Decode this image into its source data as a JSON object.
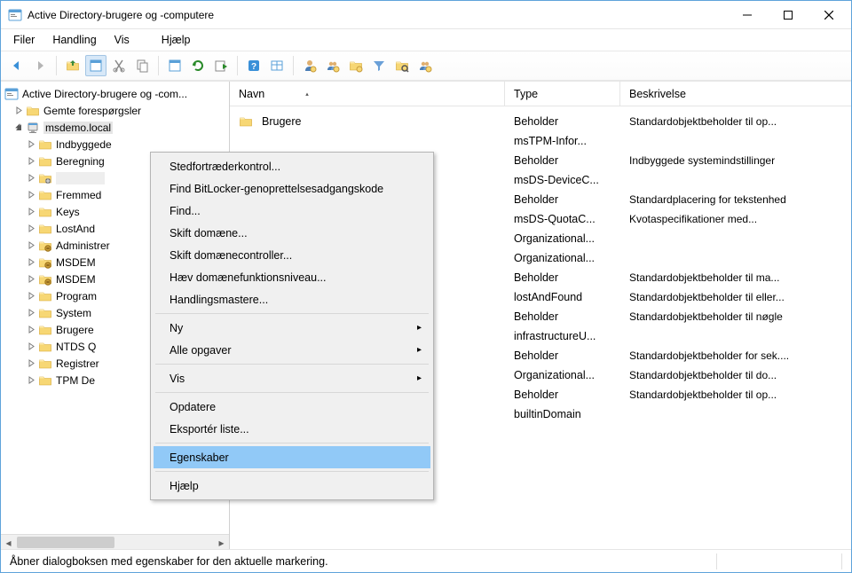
{
  "window": {
    "title": "Active Directory-brugere og -computere"
  },
  "menubar": {
    "items": [
      "Filer",
      "Handling",
      "Vis",
      "Hjælp"
    ]
  },
  "tree": {
    "root": "Active Directory-brugere og -com...",
    "saved": "Gemte forespørgsler",
    "domain": "msdemo.local",
    "children": [
      "Indbyggede",
      "Beregning",
      "",
      "Fremmed",
      "Keys",
      "LostAnd",
      "Administrer",
      "MSDEM",
      "MSDEM",
      "Program",
      "System",
      "Brugere",
      "NTDS Q",
      "Registrer",
      "TPM De"
    ]
  },
  "list": {
    "columns": {
      "name": "Navn",
      "type": "Type",
      "desc": "Beskrivelse"
    },
    "rows": [
      {
        "name": "Brugere",
        "type": "Beholder",
        "desc": "Standardobjektbeholder til op..."
      },
      {
        "name": "",
        "type": "msTPM-Infor...",
        "desc": ""
      },
      {
        "name": "",
        "type": "Beholder",
        "desc": "Indbyggede systemindstillinger"
      },
      {
        "name": "",
        "type": "msDS-DeviceC...",
        "desc": ""
      },
      {
        "name": "",
        "type": "Beholder",
        "desc": "Standardplacering for tekstenhed"
      },
      {
        "name": "",
        "type": "msDS-QuotaC...",
        "desc": "Kvotaspecifikationer med..."
      },
      {
        "name": "",
        "type": "Organizational...",
        "desc": ""
      },
      {
        "name": "",
        "type": "Organizational...",
        "desc": ""
      },
      {
        "name": "",
        "type": "Beholder",
        "desc": "Standardobjektbeholder til ma..."
      },
      {
        "name": "",
        "type": "lostAndFound",
        "desc": "Standardobjektbeholder til eller..."
      },
      {
        "name": "",
        "type": "Beholder",
        "desc": "Standardobjektbeholder til nøgle"
      },
      {
        "name": "",
        "type": "infrastructureU...",
        "desc": ""
      },
      {
        "name": "",
        "type": "Beholder",
        "desc": "Standardobjektbeholder for sek...."
      },
      {
        "name": "",
        "type": "Organizational...",
        "desc": "Standardobjektbeholder til do..."
      },
      {
        "name": "",
        "type": "Beholder",
        "desc": "Standardobjektbeholder til op..."
      },
      {
        "name": "",
        "type": "builtinDomain",
        "desc": ""
      }
    ]
  },
  "contextmenu": {
    "items": [
      {
        "label": "Stedfortræderkontrol...",
        "sub": false
      },
      {
        "label": "Find BitLocker-genoprettelsesadgangskode",
        "sub": false
      },
      {
        "label": "Find...",
        "sub": false
      },
      {
        "label": "Skift domæne...",
        "sub": false
      },
      {
        "label": "Skift domænecontroller...",
        "sub": false
      },
      {
        "label": "Hæv domænefunktionsniveau...",
        "sub": false
      },
      {
        "label": "Handlingsmastere...",
        "sub": false
      },
      {
        "sep": true
      },
      {
        "label": "Ny",
        "sub": true
      },
      {
        "label": "Alle opgaver",
        "sub": true
      },
      {
        "sep": true
      },
      {
        "label": "Vis",
        "sub": true
      },
      {
        "sep": true
      },
      {
        "label": "Opdatere",
        "sub": false
      },
      {
        "label": "Eksportér liste...",
        "sub": false
      },
      {
        "sep": true
      },
      {
        "label": "Egenskaber",
        "sub": false,
        "highlight": true
      },
      {
        "sep": true
      },
      {
        "label": "Hjælp",
        "sub": false
      }
    ]
  },
  "statusbar": {
    "text": "Åbner dialogboksen med egenskaber for den aktuelle markering."
  }
}
